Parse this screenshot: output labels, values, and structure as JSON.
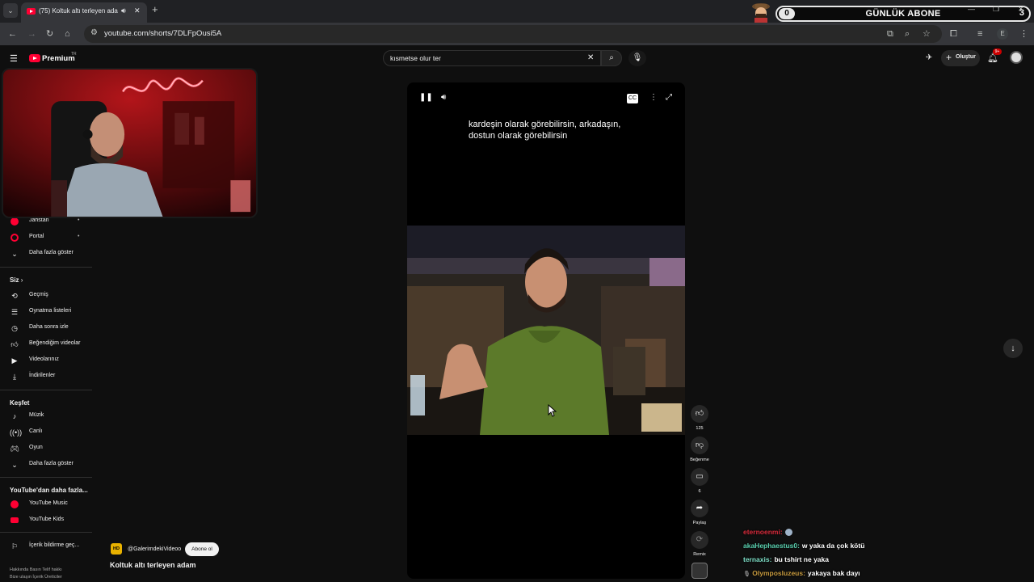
{
  "browser": {
    "tab_title": "(75) Koltuk altı terleyen ada",
    "url": "youtube.com/shorts/7DLFpOusi5A",
    "profile_initial": "E"
  },
  "stream_overlay": {
    "sub_widget_title": "GÜNLÜK ABONE",
    "sub_left_count": "0",
    "sub_right_count": "3"
  },
  "youtube": {
    "logo_text": "Premium",
    "logo_region": "TR",
    "search_query": "kısmetse olur ter",
    "create_label": "Oluştur",
    "notif_badge": "9+"
  },
  "sidebar": {
    "items_top": [
      {
        "label": "Jahstan",
        "icon": "red-circle-icon"
      },
      {
        "label": "Portal",
        "icon": "red-circle-icon"
      },
      {
        "label": "Daha fazla göster",
        "icon": "chevron-down-icon"
      }
    ],
    "you_heading": "Siz",
    "you_items": [
      {
        "label": "Geçmiş",
        "icon": "history-icon"
      },
      {
        "label": "Oynatma listeleri",
        "icon": "playlist-icon"
      },
      {
        "label": "Daha sonra izle",
        "icon": "clock-icon"
      },
      {
        "label": "Beğendiğim videolar",
        "icon": "thumbs-up-icon"
      },
      {
        "label": "Videolarınız",
        "icon": "video-icon"
      },
      {
        "label": "İndirilenler",
        "icon": "download-icon"
      }
    ],
    "explore_heading": "Keşfet",
    "explore_items": [
      {
        "label": "Müzik",
        "icon": "music-icon"
      },
      {
        "label": "Canlı",
        "icon": "live-icon"
      },
      {
        "label": "Oyun",
        "icon": "gamepad-icon"
      },
      {
        "label": "Daha fazla göster",
        "icon": "chevron-down-icon"
      }
    ],
    "more_heading": "YouTube'dan daha fazla...",
    "more_items": [
      {
        "label": "YouTube Music",
        "icon": "youtube-music-icon"
      },
      {
        "label": "YouTube Kids",
        "icon": "youtube-kids-icon"
      }
    ],
    "report_label": "İçerik bildirme geç...",
    "footer_line_1": "Hakkında   Basın   Telif hakkı",
    "footer_line_2": "Bize ulaşın   İçerik Üreticiler"
  },
  "player": {
    "caption": "kardeşin olarak görebilirsin, arkadaşın, dostun olarak görebilirsin",
    "likes": "125",
    "dislike_label": "Beğenme",
    "comments": "6",
    "share_label": "Paylaş",
    "remix_label": "Remix"
  },
  "channel": {
    "avatar_text": "HD",
    "name": "@GalerimdekiVideoo",
    "subscribe_label": "Abone ol",
    "video_title": "Koltuk altı terleyen adam"
  },
  "chat": [
    {
      "user": "eternoenmi:",
      "msg": "",
      "color": "#d62b3b",
      "badge": "emote"
    },
    {
      "user": "akaHephaestus0:",
      "msg": "w yaka da çok kötü",
      "color": "#5ad1b0"
    },
    {
      "user": "ternaxis:",
      "msg": "bu tshirt ne yaka",
      "color": "#7ee0c8"
    },
    {
      "user": "Olymposluzeus:",
      "msg": "yakaya bak dayı",
      "color": "#c79a3e",
      "badge": "mic"
    }
  ]
}
